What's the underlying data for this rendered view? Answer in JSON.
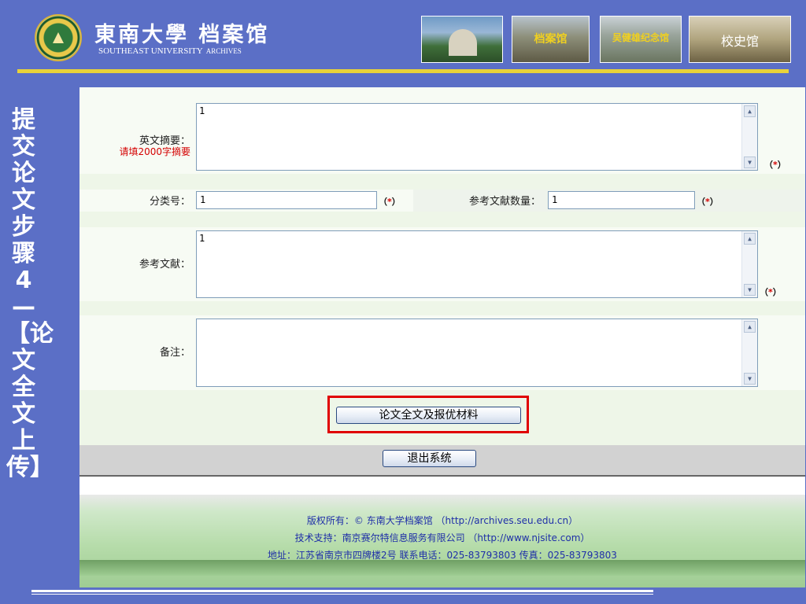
{
  "header": {
    "title_cn": "東南大學 档案馆",
    "title_en": "SOUTHEAST UNIVERSITY",
    "title_en_small": "ARCHIVES",
    "photos": [
      "",
      "档案馆",
      "吴健雄纪念馆",
      "校史馆"
    ]
  },
  "side_title": "提交论文步骤4—【论文全文上传】",
  "form": {
    "abstract_en": {
      "label": "英文摘要：",
      "hint": "请填2000字摘要",
      "value": "1",
      "required": "（*）"
    },
    "class_no": {
      "label": "分类号：",
      "value": "1",
      "required": "（*）"
    },
    "ref_count": {
      "label": "参考文献数量：",
      "value": "1",
      "required": "（*）"
    },
    "references": {
      "label": "参考文献：",
      "value": "1",
      "required": "（*）"
    },
    "remarks": {
      "label": "备注：",
      "value": ""
    },
    "submit_label": "论文全文及报优材料",
    "exit_label": "退出系统"
  },
  "footer": {
    "line1": "版权所有：© 东南大学档案馆 （http://archives.seu.edu.cn）",
    "line2": "技术支持：南京赛尔特信息服务有限公司 （http://www.njsite.com）",
    "line3": "地址：江苏省南京市四牌楼2号  联系电话：025-83793803  传真：025-83793803"
  }
}
